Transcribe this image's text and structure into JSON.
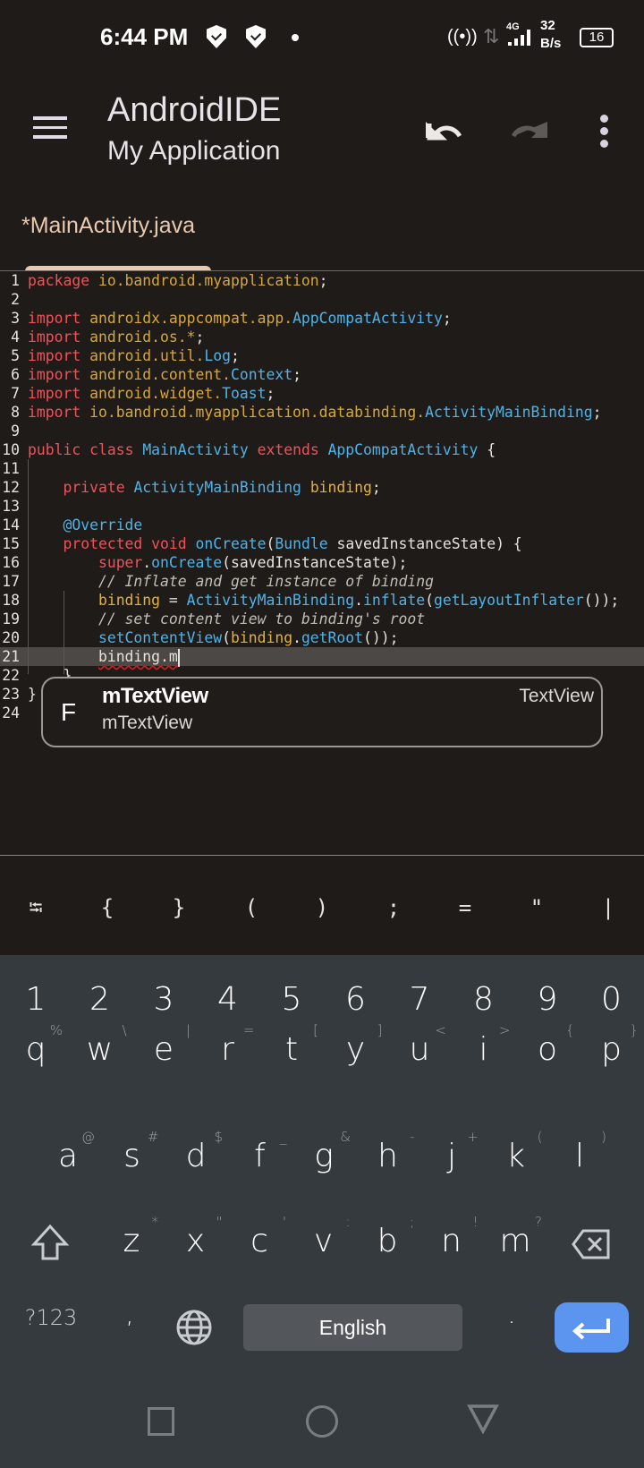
{
  "status_bar": {
    "time": "6:44 PM",
    "network_type": "4G",
    "speed_value": "32",
    "speed_unit": "B/s",
    "battery": "16",
    "icons": [
      "shield-check-icon",
      "shield-check-icon",
      "dot-icon",
      "hotspot-icon",
      "data-arrows-icon",
      "signal-icon",
      "battery-icon"
    ]
  },
  "toolbar": {
    "title": "AndroidIDE",
    "subtitle": "My Application",
    "icons": [
      "menu-icon",
      "undo-icon",
      "redo-icon",
      "more-icon"
    ]
  },
  "tab": {
    "label": "*MainActivity.java"
  },
  "editor": {
    "current_line": 21,
    "lines": [
      [
        [
          "kw",
          "package"
        ],
        [
          "pl",
          " "
        ],
        [
          "pk",
          "io.bandroid.myapplication"
        ],
        [
          "pl",
          ";"
        ]
      ],
      [],
      [
        [
          "kw",
          "import"
        ],
        [
          "pl",
          " "
        ],
        [
          "pk",
          "androidx.appcompat.app."
        ],
        [
          "cl",
          "AppCompatActivity"
        ],
        [
          "pl",
          ";"
        ]
      ],
      [
        [
          "kw",
          "import"
        ],
        [
          "pl",
          " "
        ],
        [
          "pk",
          "android.os.*"
        ],
        [
          "pl",
          ";"
        ]
      ],
      [
        [
          "kw",
          "import"
        ],
        [
          "pl",
          " "
        ],
        [
          "pk",
          "android.util."
        ],
        [
          "cl",
          "Log"
        ],
        [
          "pl",
          ";"
        ]
      ],
      [
        [
          "kw",
          "import"
        ],
        [
          "pl",
          " "
        ],
        [
          "pk",
          "android.content."
        ],
        [
          "cl",
          "Context"
        ],
        [
          "pl",
          ";"
        ]
      ],
      [
        [
          "kw",
          "import"
        ],
        [
          "pl",
          " "
        ],
        [
          "pk",
          "android.widget."
        ],
        [
          "cl",
          "Toast"
        ],
        [
          "pl",
          ";"
        ]
      ],
      [
        [
          "kw",
          "import"
        ],
        [
          "pl",
          " "
        ],
        [
          "pk",
          "io.bandroid.myapplication.databinding."
        ],
        [
          "cl",
          "ActivityMainBinding"
        ],
        [
          "pl",
          ";"
        ]
      ],
      [],
      [
        [
          "kw",
          "public"
        ],
        [
          "pl",
          " "
        ],
        [
          "kw",
          "class"
        ],
        [
          "pl",
          " "
        ],
        [
          "cl",
          "MainActivity"
        ],
        [
          "pl",
          " "
        ],
        [
          "kw",
          "extends"
        ],
        [
          "pl",
          " "
        ],
        [
          "cl",
          "AppCompatActivity"
        ],
        [
          "pl",
          " {"
        ]
      ],
      [],
      [
        [
          "pl",
          "    "
        ],
        [
          "kw",
          "private"
        ],
        [
          "pl",
          " "
        ],
        [
          "cl",
          "ActivityMainBinding"
        ],
        [
          "pl",
          " "
        ],
        [
          "vr",
          "binding"
        ],
        [
          "pl",
          ";"
        ]
      ],
      [],
      [
        [
          "pl",
          "    "
        ],
        [
          "an",
          "@Override"
        ]
      ],
      [
        [
          "pl",
          "    "
        ],
        [
          "kw",
          "protected"
        ],
        [
          "pl",
          " "
        ],
        [
          "kw",
          "void"
        ],
        [
          "pl",
          " "
        ],
        [
          "cl",
          "onCreate"
        ],
        [
          "pl",
          "("
        ],
        [
          "cl",
          "Bundle"
        ],
        [
          "pl",
          " savedInstanceState) {"
        ]
      ],
      [
        [
          "pl",
          "        "
        ],
        [
          "kw",
          "super"
        ],
        [
          "pl",
          "."
        ],
        [
          "cl",
          "onCreate"
        ],
        [
          "pl",
          "(savedInstanceState);"
        ]
      ],
      [
        [
          "pl",
          "        "
        ],
        [
          "cm",
          "// Inflate and get instance of binding"
        ]
      ],
      [
        [
          "pl",
          "        "
        ],
        [
          "vr",
          "binding"
        ],
        [
          "pl",
          " = "
        ],
        [
          "cl",
          "ActivityMainBinding"
        ],
        [
          "pl",
          "."
        ],
        [
          "cl",
          "inflate"
        ],
        [
          "pl",
          "("
        ],
        [
          "cl",
          "getLayoutInflater"
        ],
        [
          "pl",
          "());"
        ]
      ],
      [
        [
          "pl",
          "        "
        ],
        [
          "cm",
          "// set content view to binding's root"
        ]
      ],
      [
        [
          "pl",
          "        "
        ],
        [
          "cl",
          "setContentView"
        ],
        [
          "pl",
          "("
        ],
        [
          "vr",
          "binding"
        ],
        [
          "pl",
          "."
        ],
        [
          "cl",
          "getRoot"
        ],
        [
          "pl",
          "());"
        ]
      ],
      [
        [
          "pl",
          "        "
        ],
        [
          "err",
          "binding.m"
        ]
      ],
      [
        [
          "pl",
          "    }"
        ]
      ],
      [
        [
          "pl",
          "}"
        ]
      ],
      []
    ]
  },
  "completion": {
    "kind": "F",
    "label": "mTextView",
    "detail": "mTextView",
    "type": "TextView"
  },
  "symbols": [
    "⭾",
    "{",
    "}",
    "(",
    ")",
    ";",
    "=",
    "\"",
    "|"
  ],
  "keyboard": {
    "numbers": [
      "1",
      "2",
      "3",
      "4",
      "5",
      "6",
      "7",
      "8",
      "9",
      "0"
    ],
    "row1": [
      [
        "q",
        "%"
      ],
      [
        "w",
        "\\"
      ],
      [
        "e",
        "|"
      ],
      [
        "r",
        "="
      ],
      [
        "t",
        "["
      ],
      [
        "y",
        "]"
      ],
      [
        "u",
        "<"
      ],
      [
        "i",
        ">"
      ],
      [
        "o",
        "{"
      ],
      [
        "p",
        "}"
      ]
    ],
    "row2": [
      [
        "a",
        "@"
      ],
      [
        "s",
        "#"
      ],
      [
        "d",
        "$"
      ],
      [
        "f",
        "_"
      ],
      [
        "g",
        "&"
      ],
      [
        "h",
        "-"
      ],
      [
        "j",
        "+"
      ],
      [
        "k",
        "("
      ],
      [
        "l",
        ")"
      ]
    ],
    "row3": [
      [
        "z",
        "*"
      ],
      [
        "x",
        "\""
      ],
      [
        "c",
        "'"
      ],
      [
        "v",
        ":"
      ],
      [
        "b",
        ";"
      ],
      [
        "n",
        "!"
      ],
      [
        "m",
        "?"
      ]
    ],
    "symbols_key": "?123",
    "comma": ",",
    "space": "English",
    "period": ".",
    "accent": "#5b95ef"
  }
}
